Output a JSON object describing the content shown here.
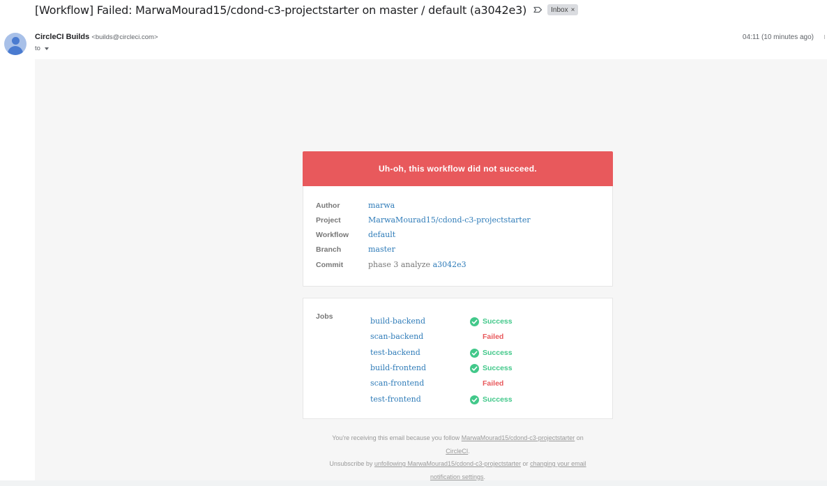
{
  "email": {
    "subject": "[Workflow] Failed: MarwaMourad15/cdond-c3-projectstarter on master / default (a3042e3)",
    "label_chip": "Inbox",
    "label_chip_close": "×",
    "sender_name": "CircleCI Builds",
    "sender_email": "<builds@circleci.com>",
    "to_text": "to",
    "time": "04:11 (10 minutes ago)"
  },
  "banner": {
    "text": "Uh-oh, this workflow did not succeed."
  },
  "details": {
    "author_label": "Author",
    "author_value": "marwa",
    "project_label": "Project",
    "project_value": "MarwaMourad15/cdond-c3-projectstarter",
    "workflow_label": "Workflow",
    "workflow_value": "default",
    "branch_label": "Branch",
    "branch_value": "master",
    "commit_label": "Commit",
    "commit_message": "phase 3 analyze",
    "commit_hash": "a3042e3"
  },
  "jobs": {
    "label": "Jobs",
    "items": [
      {
        "name": "build-backend",
        "status": "Success"
      },
      {
        "name": "scan-backend",
        "status": "Failed"
      },
      {
        "name": "test-backend",
        "status": "Success"
      },
      {
        "name": "build-frontend",
        "status": "Success"
      },
      {
        "name": "scan-frontend",
        "status": "Failed"
      },
      {
        "name": "test-frontend",
        "status": "Success"
      }
    ]
  },
  "footer": {
    "line1_prefix": "You're receiving this email because you follow",
    "line1_link": "MarwaMourad15/cdond-c3-projectstarter",
    "line1_suffix": "on",
    "line2_link": "CircleCI",
    "line2_suffix": ".",
    "line3_prefix": "Unsubscribe by",
    "line3_link1": "unfollowing MarwaMourad15/cdond-c3-projectstarter",
    "line3_or": "or",
    "line3_link2a": "changing your email",
    "line3_link2b": "notification settings",
    "line3_suffix": "."
  },
  "colors": {
    "banner": "#e8595c",
    "link": "#2e7bb8",
    "success": "#42c88a",
    "failed": "#e8595c"
  },
  "icons": {
    "label": "label-outline-icon",
    "success": "success-check-icon",
    "avatar": "person-avatar-icon"
  }
}
